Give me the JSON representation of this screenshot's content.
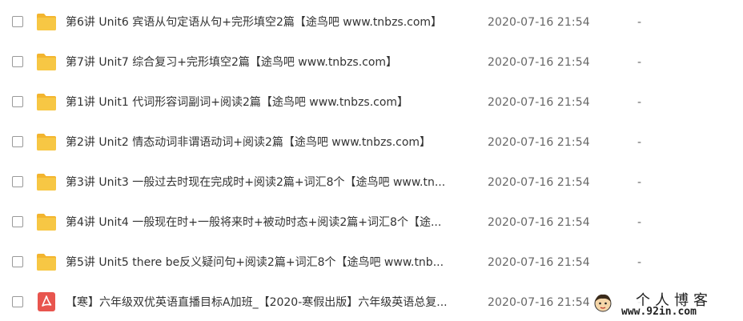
{
  "files": [
    {
      "type": "folder",
      "icon": "folder-icon",
      "name": "第6讲 Unit6 宾语从句定语从句+完形填空2篇【途鸟吧 www.tnbzs.com】",
      "modified": "2020-07-16 21:54",
      "size": "-"
    },
    {
      "type": "folder",
      "icon": "folder-icon",
      "name": "第7讲 Unit7 综合复习+完形填空2篇【途鸟吧 www.tnbzs.com】",
      "modified": "2020-07-16 21:54",
      "size": "-"
    },
    {
      "type": "folder",
      "icon": "folder-icon",
      "name": "第1讲 Unit1 代词形容词副词+阅读2篇【途鸟吧 www.tnbzs.com】",
      "modified": "2020-07-16 21:54",
      "size": "-"
    },
    {
      "type": "folder",
      "icon": "folder-icon",
      "name": "第2讲 Unit2 情态动词非谓语动词+阅读2篇【途鸟吧 www.tnbzs.com】",
      "modified": "2020-07-16 21:54",
      "size": "-"
    },
    {
      "type": "folder",
      "icon": "folder-icon",
      "name": "第3讲 Unit3 一般过去时现在完成时+阅读2篇+词汇8个【途鸟吧 www.tn...",
      "modified": "2020-07-16 21:54",
      "size": "-"
    },
    {
      "type": "folder",
      "icon": "folder-icon",
      "name": "第4讲 Unit4 一般现在时+一般将来时+被动时态+阅读2篇+词汇8个【途...",
      "modified": "2020-07-16 21:54",
      "size": "-"
    },
    {
      "type": "folder",
      "icon": "folder-icon",
      "name": "第5讲 Unit5 there be反义疑问句+阅读2篇+词汇8个【途鸟吧 www.tnb...",
      "modified": "2020-07-16 21:54",
      "size": "-"
    },
    {
      "type": "pdf",
      "icon": "pdf-icon",
      "name": "【寒】六年级双优英语直播目标A加班_【2020-寒假出版】六年级英语总复...",
      "modified": "2020-07-16 21:54",
      "size": "-"
    }
  ],
  "colors": {
    "folder": "#f7c744",
    "folder_tab": "#f3b52f",
    "pdf": "#e8554e",
    "text": "#333333",
    "meta_text": "#666666"
  },
  "watermark": {
    "title": "个人博客",
    "url": "www.92in.com"
  }
}
